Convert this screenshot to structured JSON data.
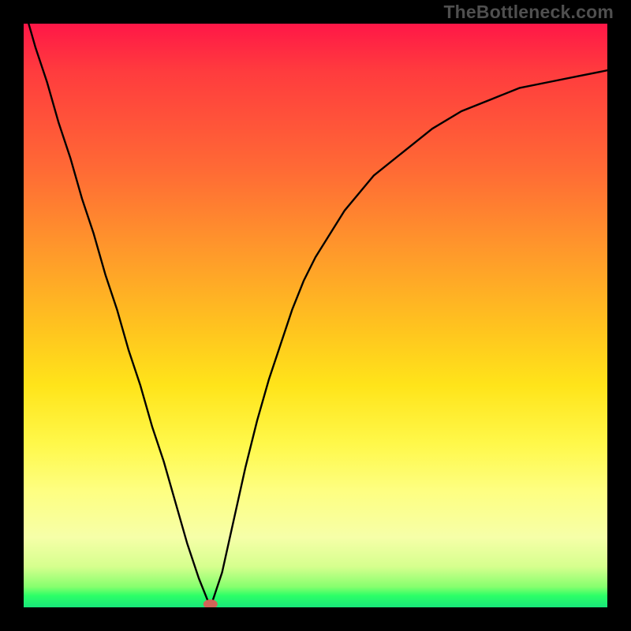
{
  "watermark": "TheBottleneck.com",
  "chart_data": {
    "type": "line",
    "title": "",
    "xlabel": "",
    "ylabel": "",
    "xlim": [
      0,
      100
    ],
    "ylim": [
      0,
      100
    ],
    "grid": false,
    "legend": false,
    "series": [
      {
        "name": "bottleneck-curve",
        "x": [
          0,
          2,
          4,
          6,
          8,
          10,
          12,
          14,
          16,
          18,
          20,
          22,
          24,
          26,
          28,
          30,
          32,
          34,
          36,
          38,
          40,
          42,
          44,
          46,
          48,
          50,
          55,
          60,
          65,
          70,
          75,
          80,
          85,
          90,
          95,
          100
        ],
        "values": [
          103,
          96,
          90,
          83,
          77,
          70,
          64,
          57,
          51,
          44,
          38,
          31,
          25,
          18,
          11,
          5,
          0,
          6,
          15,
          24,
          32,
          39,
          45,
          51,
          56,
          60,
          68,
          74,
          78,
          82,
          85,
          87,
          89,
          90,
          91,
          92
        ]
      }
    ],
    "annotations": [
      {
        "name": "min-point",
        "x": 32,
        "y": 0
      }
    ],
    "colors": {
      "curve": "#000000",
      "min_point": "#d16458",
      "gradient_top": "#ff1747",
      "gradient_mid": "#ffe41a",
      "gradient_bottom": "#18e67a"
    }
  }
}
